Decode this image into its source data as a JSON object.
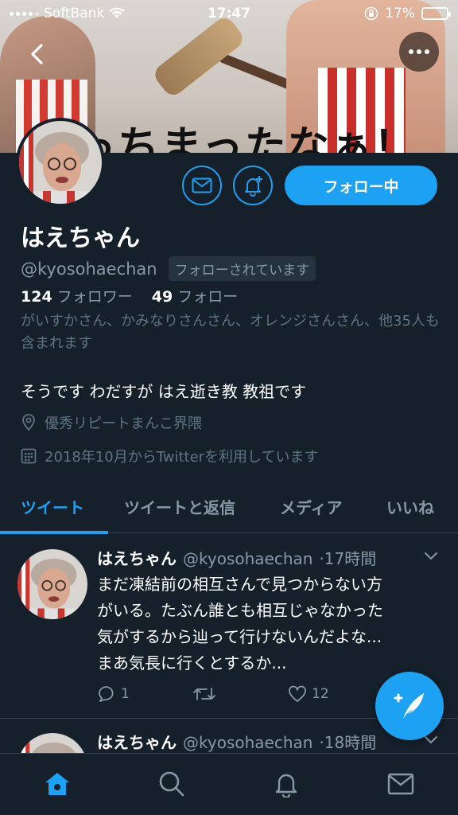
{
  "status_bar": {
    "carrier": "SoftBank",
    "time": "17:47",
    "battery": "17%"
  },
  "profile": {
    "name": "はえちゃん",
    "handle": "@kyosohaechan",
    "follows_you": "フォローされています",
    "followers_count": "124",
    "followers_label": "フォロワー",
    "following_count": "49",
    "following_label": "フォロー",
    "mutuals_text": "がいすかさん、かみなりさんさん、オレンジさんさん、他35人も含まれます",
    "bio": "そうです わだすが はえ逝き教 教祖です",
    "location": "優秀リピートまんこ界隈",
    "joined": "2018年10月からTwitterを利用しています",
    "follow_button": "フォロー中"
  },
  "banner": {
    "caption": "やっちまったなぁ！"
  },
  "tabs": [
    "ツイート",
    "ツイートと返信",
    "メディア",
    "いいね"
  ],
  "tweets": [
    {
      "name": "はえちゃん",
      "handle": "@kyosohaechan",
      "time": "·17時間",
      "lines": [
        "まだ凍結前の相互さんで見つからない方",
        "がいる。たぶん誰とも相互じゃなかった",
        "気がするから辿って行けないんだよな...",
        "まあ気長に行くとするか..."
      ],
      "replies": "1",
      "likes": "12"
    },
    {
      "name": "はえちゃん",
      "handle": "@kyosohaechan",
      "time": "·18時間"
    }
  ],
  "colors": {
    "accent": "#1da1f2",
    "background": "#15202b",
    "muted": "#8899a6"
  }
}
